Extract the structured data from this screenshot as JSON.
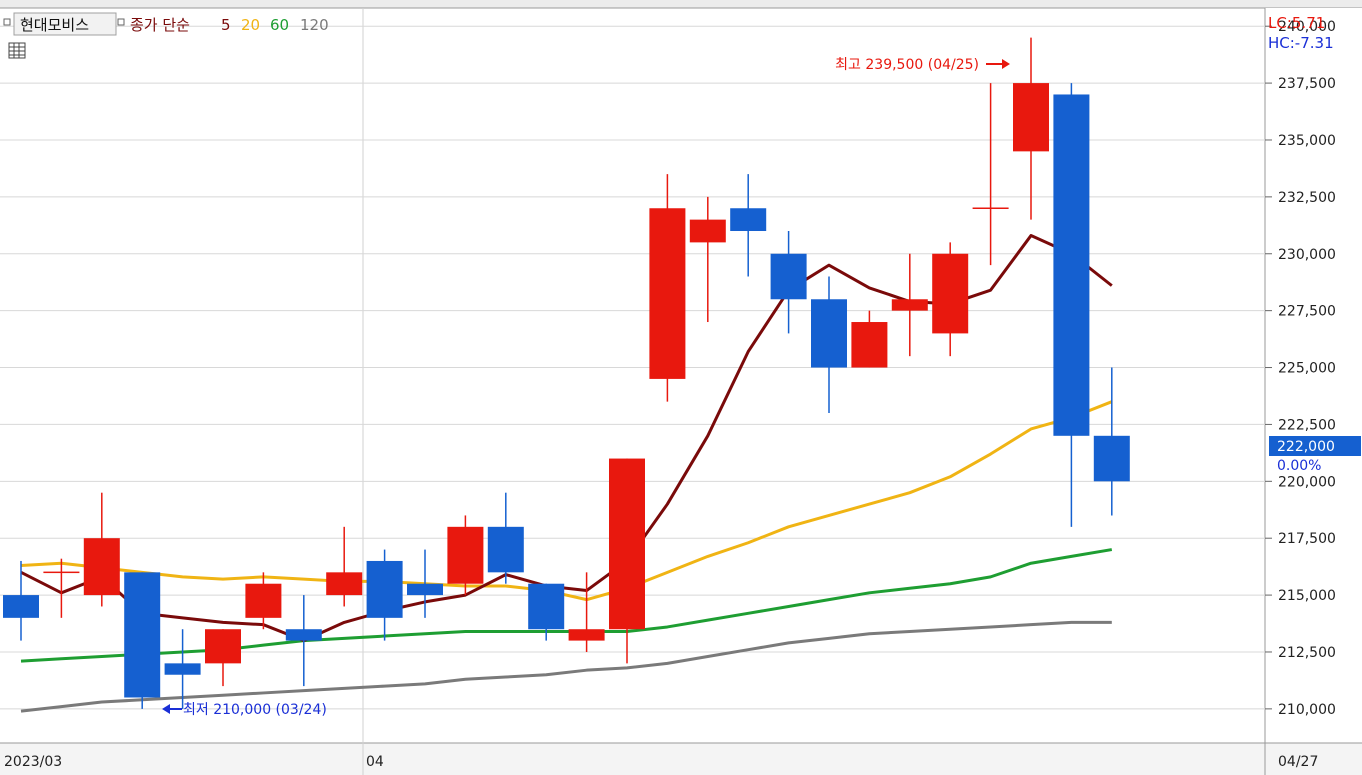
{
  "header": {
    "stock_name": "현대모비스",
    "indicator_label": "종가 단순",
    "ma_periods": [
      "5",
      "20",
      "60",
      "120"
    ]
  },
  "right_info": {
    "lc": "LC:5.71",
    "hc": "HC:-7.31",
    "last_price": "222,000",
    "last_change": "0.00%"
  },
  "annotations": {
    "high": "최고 239,500 (04/25)",
    "low": "최저 210,000 (03/24)"
  },
  "x_axis": {
    "left_label": "2023/03",
    "month_label": "04",
    "right_label": "04/27"
  },
  "colors": {
    "up": "#e8180e",
    "down": "#1560d0",
    "ma5": "#7a0a0a",
    "ma20": "#f0b414",
    "ma60": "#1e9e32",
    "ma120": "#7a7a7a",
    "text_red": "#e8180e",
    "text_blue": "#1a2fd6",
    "grid": "#d8d8d8",
    "panel_border": "#9a9a9a"
  },
  "chart_data": {
    "type": "candlestick",
    "y_ticks": [
      210000,
      212500,
      215000,
      217500,
      220000,
      222500,
      225000,
      227500,
      230000,
      232500,
      235000,
      237500,
      240000
    ],
    "ylim": [
      208500,
      240800
    ],
    "candles": [
      {
        "o": 215000,
        "h": 216500,
        "l": 213000,
        "c": 214000
      },
      {
        "o": 216000,
        "h": 216600,
        "l": 214000,
        "c": 216000
      },
      {
        "o": 215000,
        "h": 219500,
        "l": 214500,
        "c": 217500
      },
      {
        "o": 216000,
        "h": 216000,
        "l": 210000,
        "c": 210500
      },
      {
        "o": 212000,
        "h": 213500,
        "l": 210000,
        "c": 211500
      },
      {
        "o": 212000,
        "h": 213500,
        "l": 211000,
        "c": 213500
      },
      {
        "o": 214000,
        "h": 216000,
        "l": 213500,
        "c": 215500
      },
      {
        "o": 213500,
        "h": 215000,
        "l": 211000,
        "c": 213000
      },
      {
        "o": 215000,
        "h": 218000,
        "l": 214500,
        "c": 216000
      },
      {
        "o": 216500,
        "h": 217000,
        "l": 213000,
        "c": 214000
      },
      {
        "o": 215500,
        "h": 217000,
        "l": 214000,
        "c": 215000
      },
      {
        "o": 215500,
        "h": 218500,
        "l": 215000,
        "c": 218000
      },
      {
        "o": 218000,
        "h": 219500,
        "l": 215500,
        "c": 216000
      },
      {
        "o": 215500,
        "h": 215500,
        "l": 213000,
        "c": 213500
      },
      {
        "o": 213000,
        "h": 216000,
        "l": 212500,
        "c": 213500
      },
      {
        "o": 213500,
        "h": 221000,
        "l": 212000,
        "c": 221000
      },
      {
        "o": 224500,
        "h": 233500,
        "l": 223500,
        "c": 232000
      },
      {
        "o": 230500,
        "h": 232500,
        "l": 227000,
        "c": 231500
      },
      {
        "o": 232000,
        "h": 233500,
        "l": 229000,
        "c": 231000
      },
      {
        "o": 230000,
        "h": 231000,
        "l": 226500,
        "c": 228000
      },
      {
        "o": 228000,
        "h": 229000,
        "l": 223000,
        "c": 225000
      },
      {
        "o": 225000,
        "h": 227500,
        "l": 225000,
        "c": 227000
      },
      {
        "o": 227500,
        "h": 230000,
        "l": 225500,
        "c": 228000
      },
      {
        "o": 226500,
        "h": 230500,
        "l": 225500,
        "c": 230000
      },
      {
        "o": 232000,
        "h": 237500,
        "l": 229500,
        "c": 232000
      },
      {
        "o": 234500,
        "h": 239500,
        "l": 231500,
        "c": 237500
      },
      {
        "o": 237000,
        "h": 237500,
        "l": 218000,
        "c": 222000
      },
      {
        "o": 222000,
        "h": 225000,
        "l": 218500,
        "c": 220000
      }
    ],
    "ma5": [
      216000,
      215100,
      215800,
      214200,
      214000,
      213800,
      213700,
      213000,
      213800,
      214300,
      214700,
      215000,
      215900,
      215400,
      215200,
      216500,
      219000,
      222000,
      225700,
      228400,
      229500,
      228500,
      227900,
      227800,
      228400,
      230800,
      230000,
      228600
    ],
    "ma20": [
      216300,
      216400,
      216200,
      216000,
      215800,
      215700,
      215800,
      215700,
      215600,
      215600,
      215500,
      215400,
      215400,
      215200,
      214800,
      215300,
      216000,
      216700,
      217300,
      218000,
      218500,
      219000,
      219500,
      220200,
      221200,
      222300,
      222800,
      223500
    ],
    "ma60": [
      212100,
      212200,
      212300,
      212400,
      212500,
      212600,
      212800,
      213000,
      213100,
      213200,
      213300,
      213400,
      213400,
      213400,
      213400,
      213400,
      213600,
      213900,
      214200,
      214500,
      214800,
      215100,
      215300,
      215500,
      215800,
      216400,
      216700,
      217000
    ],
    "ma120": [
      209900,
      210100,
      210300,
      210400,
      210500,
      210600,
      210700,
      210800,
      210900,
      211000,
      211100,
      211300,
      211400,
      211500,
      211700,
      211800,
      212000,
      212300,
      212600,
      212900,
      213100,
      213300,
      213400,
      213500,
      213600,
      213700,
      213800,
      213800
    ]
  }
}
